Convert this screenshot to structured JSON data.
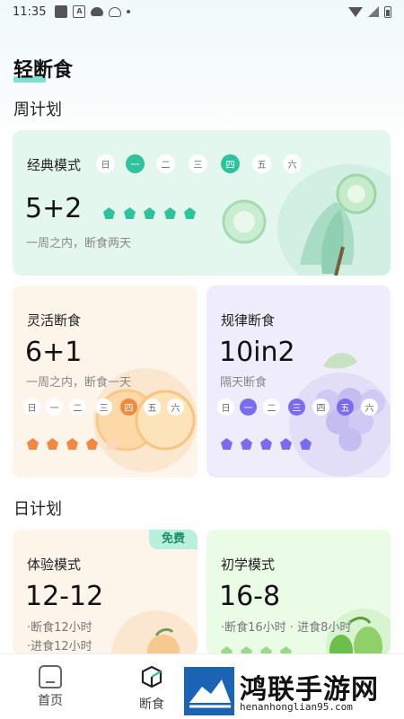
{
  "status_bar": {
    "time": "11:35",
    "icon_a": "A"
  },
  "page": {
    "title": "轻断食"
  },
  "weekly": {
    "section_title": "周计划",
    "classic": {
      "title": "经典模式",
      "big": "5+2",
      "sub": "一周之内，断食两天",
      "days": [
        "日",
        "一",
        "二",
        "三",
        "四",
        "五",
        "六"
      ],
      "active_days": [
        1,
        4
      ],
      "accent": "#2ec39a"
    },
    "flexible": {
      "title": "灵活断食",
      "big": "6+1",
      "sub": "一周之内，断食一天",
      "days": [
        "日",
        "一",
        "二",
        "三",
        "四",
        "五",
        "六"
      ],
      "active_days": [
        4
      ],
      "accent": "#f08a43"
    },
    "regular": {
      "title": "规律断食",
      "big": "10in2",
      "sub": "隔天断食",
      "days": [
        "日",
        "一",
        "二",
        "三",
        "四",
        "五",
        "六"
      ],
      "active_days": [
        1,
        3,
        5
      ],
      "accent": "#7a6cf0"
    }
  },
  "daily": {
    "section_title": "日计划",
    "trial": {
      "title": "体验模式",
      "badge": "免费",
      "big": "12-12",
      "line1": "·断食12小时",
      "line2": "·进食12小时"
    },
    "beginner": {
      "title": "初学模式",
      "big": "16-8",
      "line1": "·断食16小时 · 进食8小时"
    }
  },
  "tabbar": {
    "home": "首页",
    "fasting": "断食"
  },
  "watermark": {
    "name": "鸿联手游网",
    "url": "henanhonglian95.com"
  }
}
